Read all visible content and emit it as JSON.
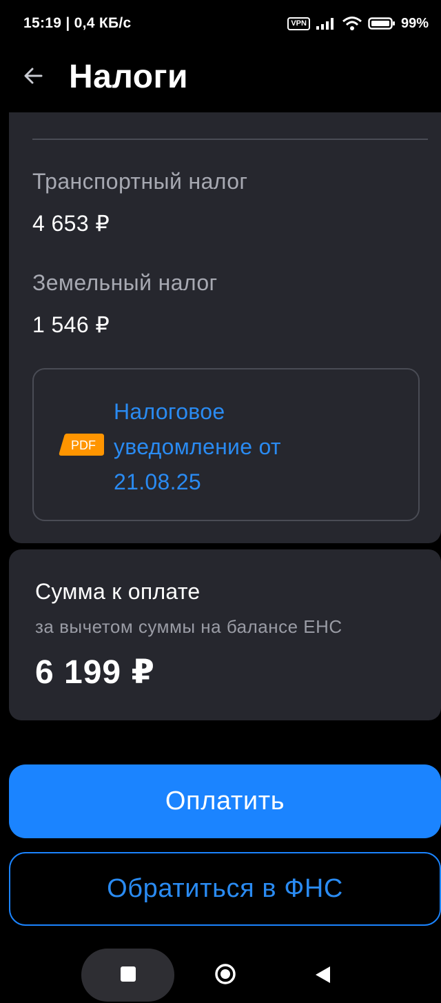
{
  "status_bar": {
    "time_speed": "15:19 | 0,4 КБ/с",
    "vpn": "VPN",
    "battery": "99%"
  },
  "app_bar": {
    "title": "Налоги"
  },
  "taxes": [
    {
      "name": "Транспортный налог",
      "amount": "4 653 ₽"
    },
    {
      "name": "Земельный налог",
      "amount": "1 546 ₽"
    }
  ],
  "document": {
    "badge": "PDF",
    "line1": "Налоговое",
    "line2": "уведомление от",
    "line3": "21.08.25"
  },
  "summary": {
    "label": "Сумма к оплате",
    "sublabel": "за вычетом суммы на балансе ЕНС",
    "value": "6 199 ₽"
  },
  "buttons": {
    "pay": "Оплатить",
    "contact": "Обратиться в ФНС"
  },
  "colors": {
    "accent": "#1b84ff",
    "link": "#2a8bf2",
    "card": "#26272e",
    "pdf_badge": "#ff9500"
  }
}
